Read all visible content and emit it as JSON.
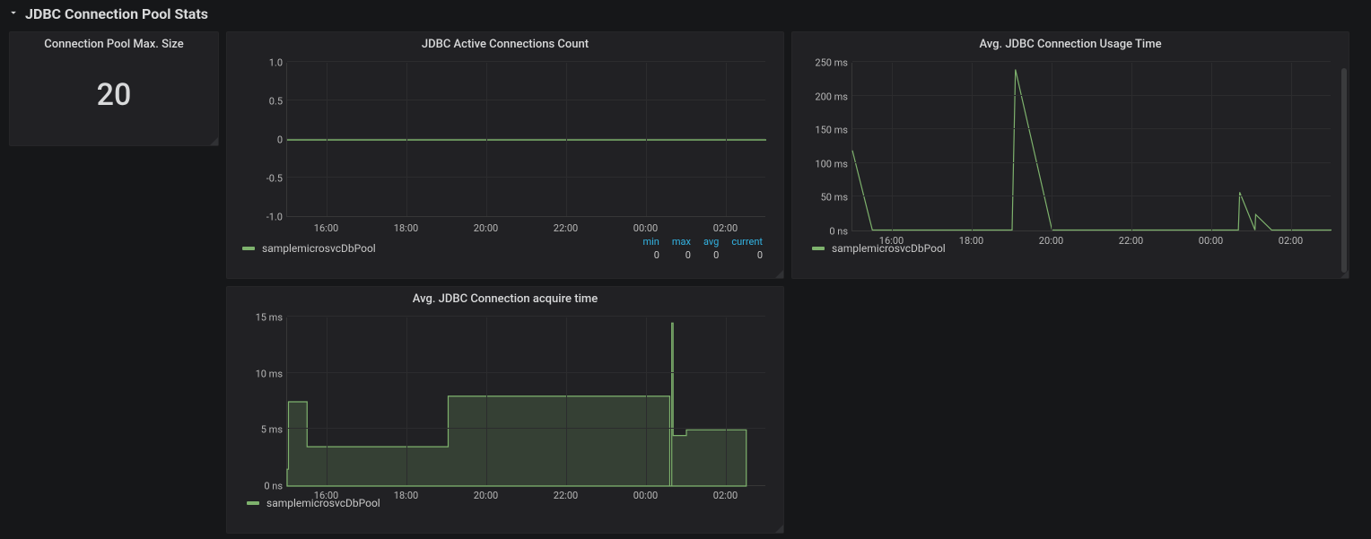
{
  "section_title": "JDBC Connection Pool Stats",
  "stat_panel": {
    "title": "Connection Pool Max. Size",
    "value": "20"
  },
  "legend_series": "samplemicrosvcDbPool",
  "x_ticks": [
    "16:00",
    "18:00",
    "20:00",
    "22:00",
    "00:00",
    "02:00"
  ],
  "active": {
    "title": "JDBC Active Connections Count",
    "y_ticks": [
      "-1.0",
      "-0.5",
      "0",
      "0.5",
      "1.0"
    ],
    "stats": {
      "headers": [
        "min",
        "max",
        "avg",
        "current"
      ],
      "values": [
        "0",
        "0",
        "0",
        "0"
      ]
    }
  },
  "usage": {
    "title": "Avg. JDBC Connection Usage Time",
    "y_ticks": [
      "0 ns",
      "50 ms",
      "100 ms",
      "150 ms",
      "200 ms",
      "250 ms"
    ]
  },
  "acquire": {
    "title": "Avg. JDBC Connection acquire time",
    "y_ticks": [
      "0 ns",
      "5 ms",
      "10 ms",
      "15 ms"
    ]
  },
  "chart_data": [
    {
      "id": "active",
      "type": "line",
      "title": "JDBC Active Connections Count",
      "xlabel": "",
      "ylabel": "",
      "x_tick_labels": [
        "16:00",
        "18:00",
        "20:00",
        "22:00",
        "00:00",
        "02:00"
      ],
      "ylim": [
        -1.0,
        1.0
      ],
      "series": [
        {
          "name": "samplemicrosvcDbPool",
          "constant_value": 0
        }
      ],
      "summary": {
        "min": 0,
        "max": 0,
        "avg": 0,
        "current": 0
      }
    },
    {
      "id": "usage",
      "type": "line",
      "title": "Avg. JDBC Connection Usage Time",
      "xlabel": "",
      "ylabel": "ms",
      "x_tick_labels": [
        "16:00",
        "18:00",
        "20:00",
        "22:00",
        "00:00",
        "02:00"
      ],
      "ylim": [
        0,
        250
      ],
      "series": [
        {
          "name": "samplemicrosvcDbPool",
          "x": [
            "15:00",
            "15:30",
            "16:00",
            "18:00",
            "19:00",
            "19:05",
            "20:00",
            "22:00",
            "00:00",
            "00:40",
            "00:42",
            "01:05",
            "01:06",
            "01:30",
            "02:00",
            "03:00"
          ],
          "y": [
            120,
            2,
            2,
            2,
            2,
            240,
            2,
            2,
            2,
            2,
            58,
            2,
            25,
            2,
            2,
            2
          ]
        }
      ]
    },
    {
      "id": "acquire",
      "type": "area",
      "title": "Avg. JDBC Connection acquire time",
      "xlabel": "",
      "ylabel": "ms",
      "x_tick_labels": [
        "16:00",
        "18:00",
        "20:00",
        "22:00",
        "00:00",
        "02:00"
      ],
      "ylim": [
        0,
        15
      ],
      "series": [
        {
          "name": "samplemicrosvcDbPool",
          "x": [
            "15:00",
            "15:02",
            "15:30",
            "16:00",
            "18:00",
            "19:00",
            "19:02",
            "20:00",
            "22:00",
            "00:00",
            "00:30",
            "00:35",
            "00:38",
            "00:40",
            "01:00",
            "02:00",
            "02:25",
            "02:30"
          ],
          "y": [
            1.5,
            7.5,
            3.5,
            3.5,
            3.5,
            3.5,
            8.0,
            8.0,
            8.0,
            8.0,
            8.0,
            0,
            14.5,
            4.5,
            5.0,
            5.0,
            5.0,
            2.0
          ]
        }
      ]
    }
  ]
}
